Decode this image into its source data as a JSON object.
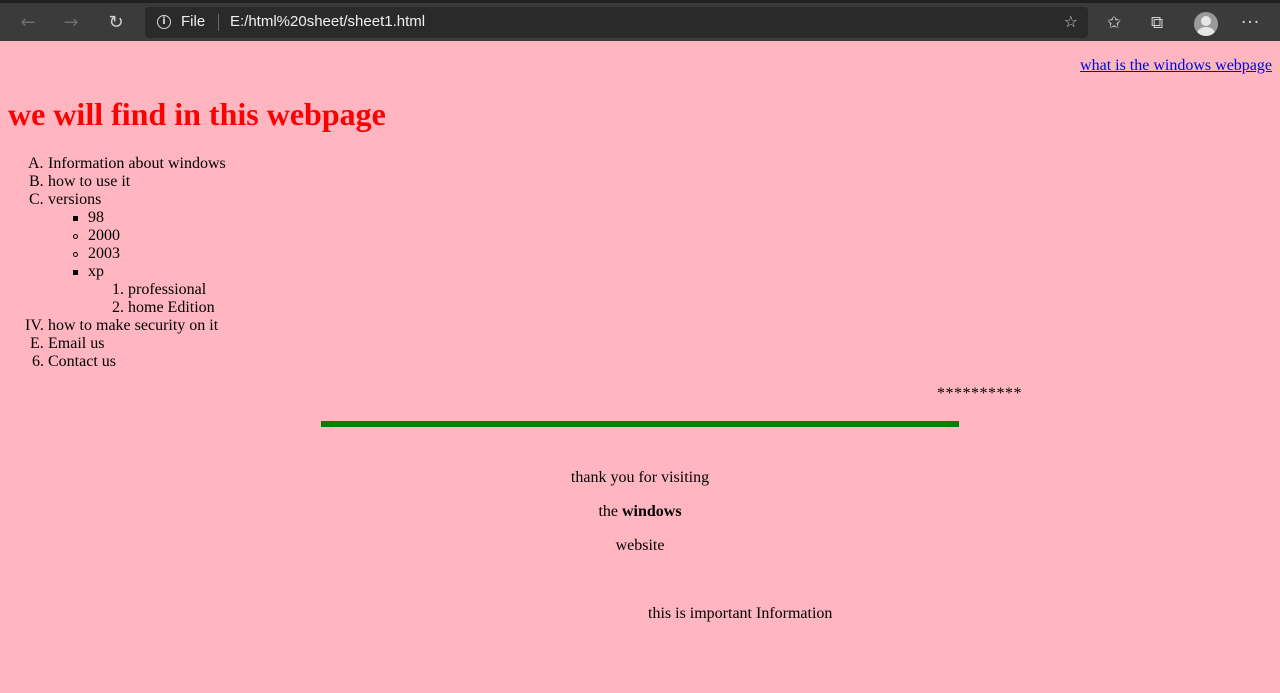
{
  "browser": {
    "file_label": "File",
    "url": "E:/html%20sheet/sheet1.html",
    "back_icon": "←",
    "forward_icon": "→",
    "reload_icon": "↻",
    "favorite_icon": "☆",
    "favorites_icon": "✩",
    "collections_icon": "⧉",
    "more_icon": "···"
  },
  "page": {
    "top_link": "what is the windows webpage",
    "heading": "we will find in this webpage",
    "outline": {
      "item_a_marker": "A.",
      "item_a": "Information about windows",
      "item_b_marker": "B.",
      "item_b": "how to use it",
      "item_c_marker": "C.",
      "item_c": "versions",
      "versions": [
        "98",
        "2000",
        "2003",
        "xp"
      ],
      "xp_1_marker": "1.",
      "xp_1": "professional",
      "xp_2_marker": "2.",
      "xp_2": "home Edition",
      "item_iv_marker": "IV.",
      "item_iv": "how to make security on it",
      "item_e_marker": "E.",
      "item_e": "Email us",
      "item_6_marker": "6.",
      "item_6": "Contact us"
    },
    "stars": "**********",
    "thanks_line": "thank you for visiting",
    "the_prefix": "the",
    "windows_bold": "windows",
    "website_line": "website",
    "important": "this is important Information"
  },
  "colors": {
    "background": "#ffb6c1",
    "heading": "#ff0000",
    "rule": "#008000",
    "link": "#0000ee"
  }
}
